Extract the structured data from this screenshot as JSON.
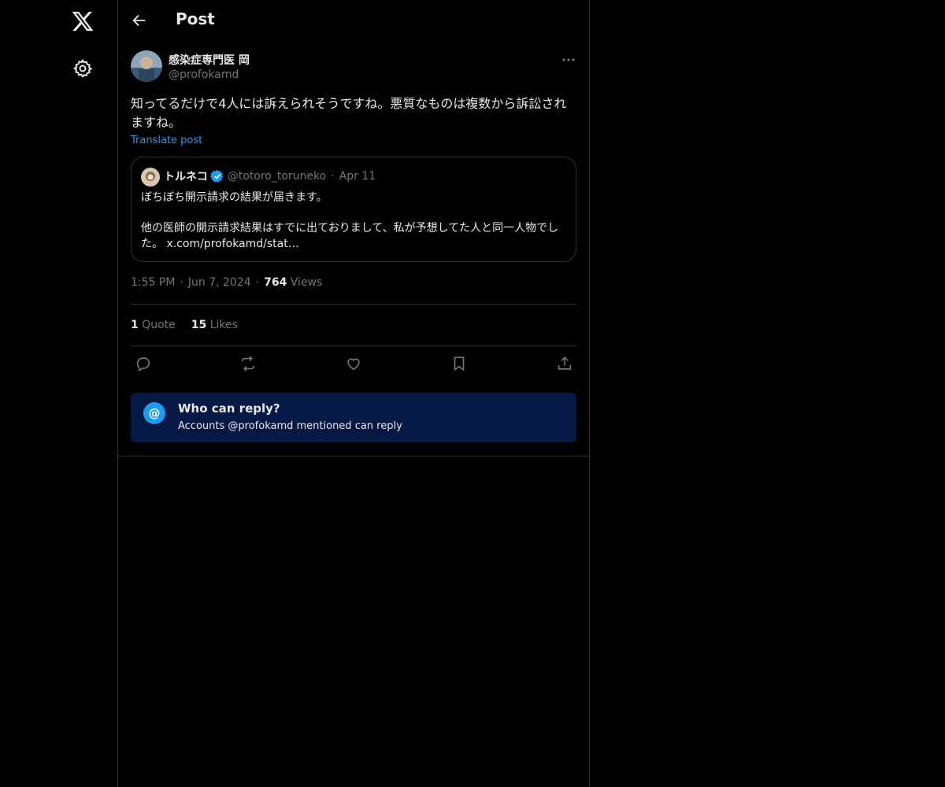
{
  "header": {
    "title": "Post"
  },
  "post": {
    "author_name": "感染症専門医 岡",
    "author_handle": "@profokamd",
    "text": "知ってるだけで4人には訴えられそうですね。悪質なものは複数から訴訟されますね。",
    "translate_label": "Translate post",
    "time": "1:55 PM",
    "date": "Jun 7, 2024",
    "views_count": "764",
    "views_label": "Views",
    "quotes_count": "1",
    "quotes_label": "Quote",
    "likes_count": "15",
    "likes_label": "Likes"
  },
  "quoted_post": {
    "author_name": "トルネコ",
    "author_handle": "@totoro_toruneko",
    "date": "Apr 11",
    "line1": "ぼちぼち開示請求の結果が届きます。",
    "line2": "他の医師の開示請求結果はすでに出ておりまして、私が予想してた人と同一人物でした。 x.com/profokamd/stat…"
  },
  "reply_restriction": {
    "title": "Who can reply?",
    "subtitle": "Accounts @profokamd mentioned can reply"
  },
  "icons": {
    "logo": "x-logo-icon",
    "settings": "gear-icon",
    "back": "arrow-left-icon",
    "more": "more-horizontal-icon",
    "verified": "verified-badge-icon",
    "reply": "reply-icon",
    "repost": "repost-icon",
    "like": "heart-icon",
    "bookmark": "bookmark-icon",
    "share": "share-icon",
    "mention": "at-icon"
  },
  "colors": {
    "background": "#000000",
    "text": "#e7e9ea",
    "muted": "#71767b",
    "accent": "#1d9bf0",
    "border": "#2f3336",
    "notice_bg": "#061844"
  }
}
